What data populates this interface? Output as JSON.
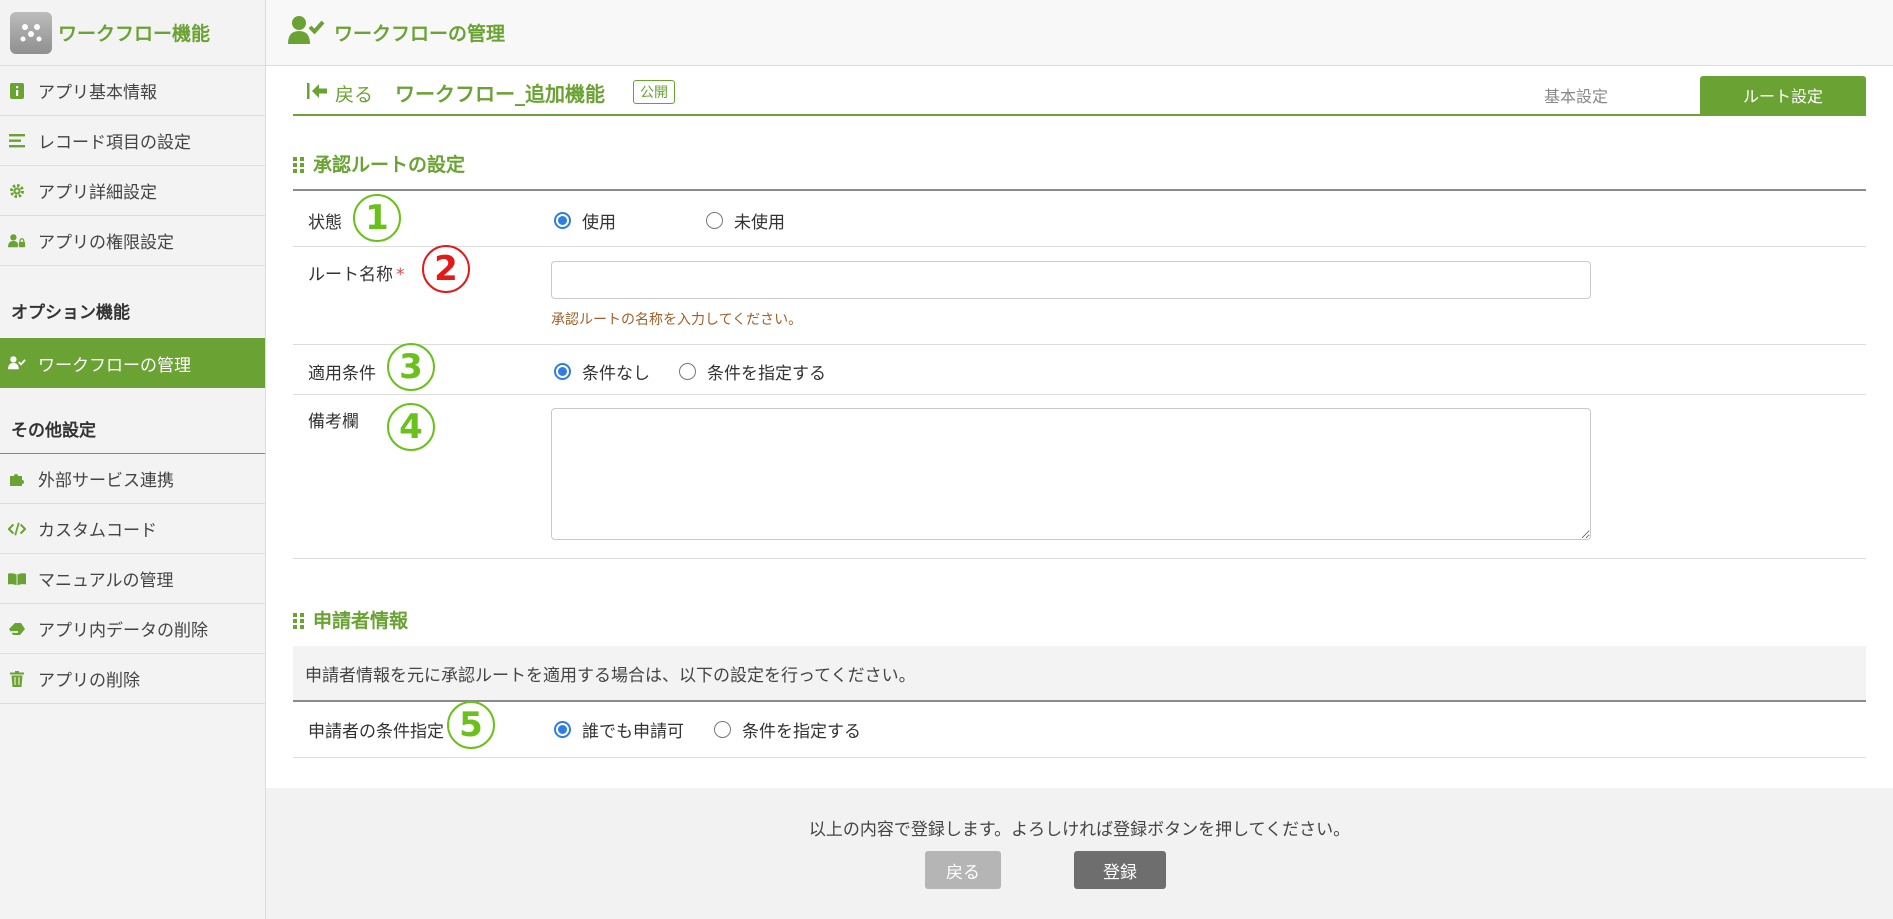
{
  "app": {
    "name": "ワークフロー機能"
  },
  "header": {
    "title": "ワークフローの管理"
  },
  "sidebar": {
    "items": [
      {
        "label": "アプリ基本情報",
        "icon": "info-icon"
      },
      {
        "label": "レコード項目の設定",
        "icon": "list-icon"
      },
      {
        "label": "アプリ詳細設定",
        "icon": "gear-icon"
      },
      {
        "label": "アプリの権限設定",
        "icon": "user-lock-icon"
      }
    ],
    "option_section": "オプション機能",
    "option_items": [
      {
        "label": "ワークフローの管理",
        "icon": "user-check-icon",
        "active": true
      }
    ],
    "other_section": "その他設定",
    "other_items": [
      {
        "label": "外部サービス連携",
        "icon": "puzzle-icon"
      },
      {
        "label": "カスタムコード",
        "icon": "code-icon"
      },
      {
        "label": "マニュアルの管理",
        "icon": "book-icon"
      },
      {
        "label": "アプリ内データの削除",
        "icon": "eraser-icon"
      },
      {
        "label": "アプリの削除",
        "icon": "trash-icon"
      }
    ]
  },
  "titlebar": {
    "back_label": "戻る",
    "workflow_name": "ワークフロー_追加機能",
    "badge": "公開",
    "tabs": [
      {
        "label": "基本設定",
        "active": false
      },
      {
        "label": "ルート設定",
        "active": true
      }
    ]
  },
  "route_section": {
    "title": "承認ルートの設定",
    "status": {
      "label": "状態",
      "number": "1",
      "options": [
        "使用",
        "未使用"
      ],
      "selected": "使用"
    },
    "route_name": {
      "label": "ルート名称",
      "required_mark": "*",
      "number": "2",
      "value": "",
      "help": "承認ルートの名称を入力してください。"
    },
    "condition": {
      "label": "適用条件",
      "number": "3",
      "options": [
        "条件なし",
        "条件を指定する"
      ],
      "selected": "条件なし"
    },
    "remarks": {
      "label": "備考欄",
      "number": "4",
      "value": ""
    }
  },
  "applicant_section": {
    "title": "申請者情報",
    "info": "申請者情報を元に承認ルートを適用する場合は、以下の設定を行ってください。",
    "condition": {
      "label": "申請者の条件指定",
      "number": "5",
      "options": [
        "誰でも申請可",
        "条件を指定する"
      ],
      "selected": "誰でも申請可"
    }
  },
  "footer": {
    "message": "以上の内容で登録します。よろしければ登録ボタンを押してください。",
    "back_button": "戻る",
    "save_button": "登録"
  },
  "colors": {
    "accent": "#6aa233",
    "number_green": "#6ac11b",
    "number_red": "#e21a1a",
    "radio_blue": "#2f7de1"
  }
}
